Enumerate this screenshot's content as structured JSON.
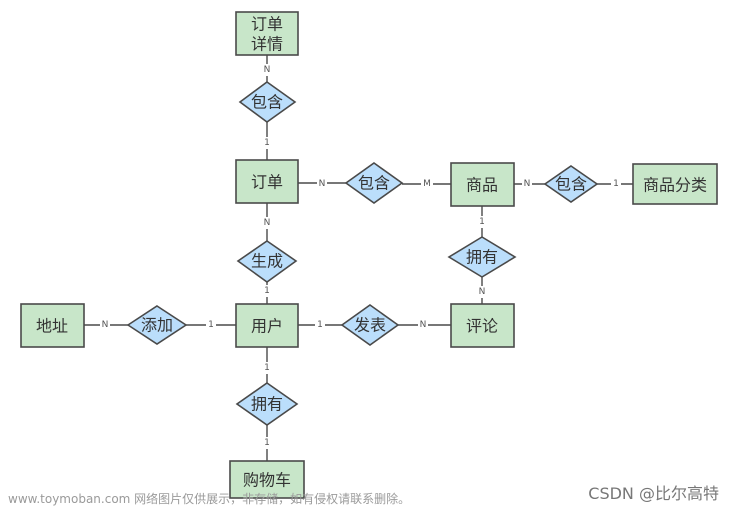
{
  "entities": {
    "order_detail": [
      "订单",
      "详情"
    ],
    "order": "订单",
    "product": "商品",
    "category": "商品分类",
    "review": "评论",
    "user": "用户",
    "address": "地址",
    "cart": "购物车"
  },
  "relationships": {
    "contains_detail": "包含",
    "contains_product": "包含",
    "contains_category": "包含",
    "product_has_review": "拥有",
    "publish": "发表",
    "generate": "生成",
    "add": "添加",
    "user_has_cart": "拥有"
  },
  "cardinality": {
    "detail_side": "N",
    "order_detail_side": "1",
    "order_product_side": "N",
    "product_order_side": "M",
    "product_cat_side": "N",
    "category_side": "1",
    "product_review_side": "1",
    "review_product_side": "N",
    "review_user_side": "N",
    "user_review_side": "1",
    "order_user_side": "N",
    "user_order_side": "1",
    "address_side": "N",
    "user_address_side": "1",
    "user_cart_side": "1",
    "cart_side": "1"
  },
  "colors": {
    "entity": "#c8e6c9",
    "relationship": "#bbdefb",
    "stroke": "#4a4a4a"
  },
  "watermark": {
    "left": "www.toymoban.com 网络图片仅供展示，非存储，如有侵权请联系删除。",
    "right": "CSDN @比尔高特"
  }
}
